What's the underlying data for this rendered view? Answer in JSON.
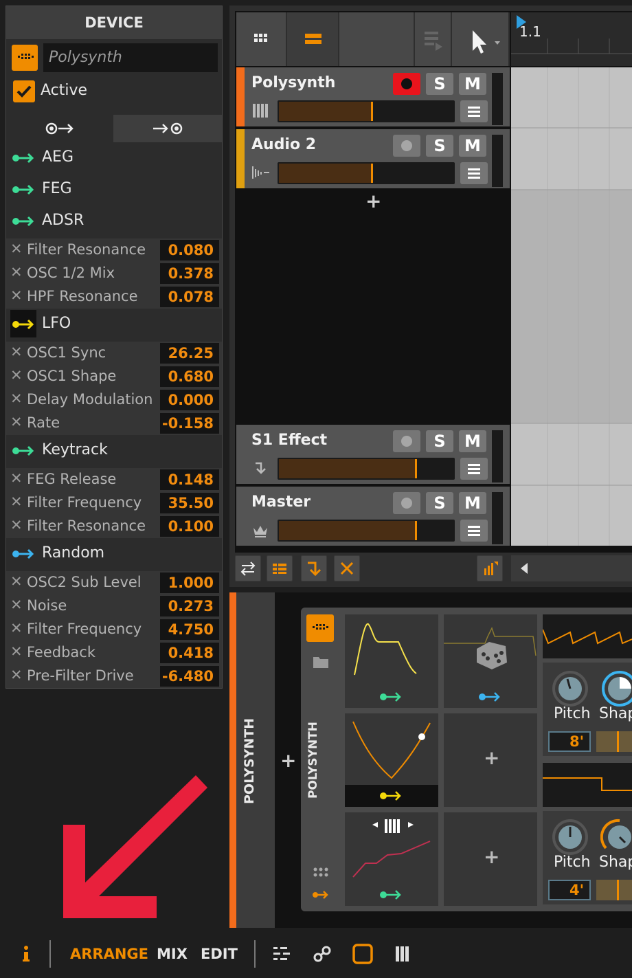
{
  "device_panel": {
    "title": "DEVICE",
    "device_name": "Polysynth",
    "active_label": "Active",
    "modulators": [
      {
        "name": "AEG",
        "color": "#3ddc97",
        "params": []
      },
      {
        "name": "FEG",
        "color": "#3ddc97",
        "params": []
      },
      {
        "name": "ADSR",
        "color": "#3ddc97",
        "params": [
          {
            "name": "Filter Resonance",
            "value": "0.080"
          },
          {
            "name": "OSC 1/2 Mix",
            "value": "0.378"
          },
          {
            "name": "HPF Resonance",
            "value": "0.078"
          }
        ]
      },
      {
        "name": "LFO",
        "color": "#f5d90a",
        "params": [
          {
            "name": "OSC1 Sync",
            "value": "26.25"
          },
          {
            "name": "OSC1 Shape",
            "value": "0.680"
          },
          {
            "name": "Delay Modulation",
            "value": "0.000"
          },
          {
            "name": "Rate",
            "value": "-0.158"
          }
        ]
      },
      {
        "name": "Keytrack",
        "color": "#3ddc97",
        "params": [
          {
            "name": "FEG Release",
            "value": "0.148"
          },
          {
            "name": "Filter Frequency",
            "value": "35.50"
          },
          {
            "name": "Filter Resonance",
            "value": "0.100"
          }
        ]
      },
      {
        "name": "Random",
        "color": "#3cb4f0",
        "params": [
          {
            "name": "OSC2 Sub Level",
            "value": "1.000"
          },
          {
            "name": "Noise",
            "value": "0.273"
          },
          {
            "name": "Filter Frequency",
            "value": "4.750"
          },
          {
            "name": "Feedback",
            "value": "0.418"
          },
          {
            "name": "Pre-Filter Drive",
            "value": "-6.480"
          }
        ]
      }
    ],
    "delete_glyph": "✕"
  },
  "arranger": {
    "timeline_marker": "1.1",
    "add_track_glyph": "+",
    "tracks": [
      {
        "name": "Polysynth",
        "color": "#f26c1c",
        "solo": "S",
        "mute": "M",
        "armed": true,
        "volume": 0.53
      },
      {
        "name": "Audio 2",
        "color": "#e0a010",
        "solo": "S",
        "mute": "M",
        "armed": false,
        "volume": 0.53
      },
      {
        "name": "S1 Effect",
        "color": "",
        "solo": "S",
        "mute": "M",
        "armed": false,
        "volume": 0.78
      },
      {
        "name": "Master",
        "color": "",
        "solo": "S",
        "mute": "M",
        "armed": false,
        "volume": 0.78
      }
    ]
  },
  "chain": {
    "device_label": "POLYSYNTH",
    "inner_label": "POLYSYNTH",
    "add_glyph": "+",
    "knobs": [
      {
        "label": "Pitch",
        "value": "8'"
      },
      {
        "label": "Shap"
      },
      {
        "label": "Pitch",
        "value": "4'"
      },
      {
        "label": "Shap"
      }
    ]
  },
  "footer": {
    "tabs": [
      "ARRANGE",
      "MIX",
      "EDIT"
    ],
    "active_tab": "ARRANGE",
    "accent": "#f08c00"
  },
  "annotation": {
    "arrow_color": "#e8203c"
  }
}
